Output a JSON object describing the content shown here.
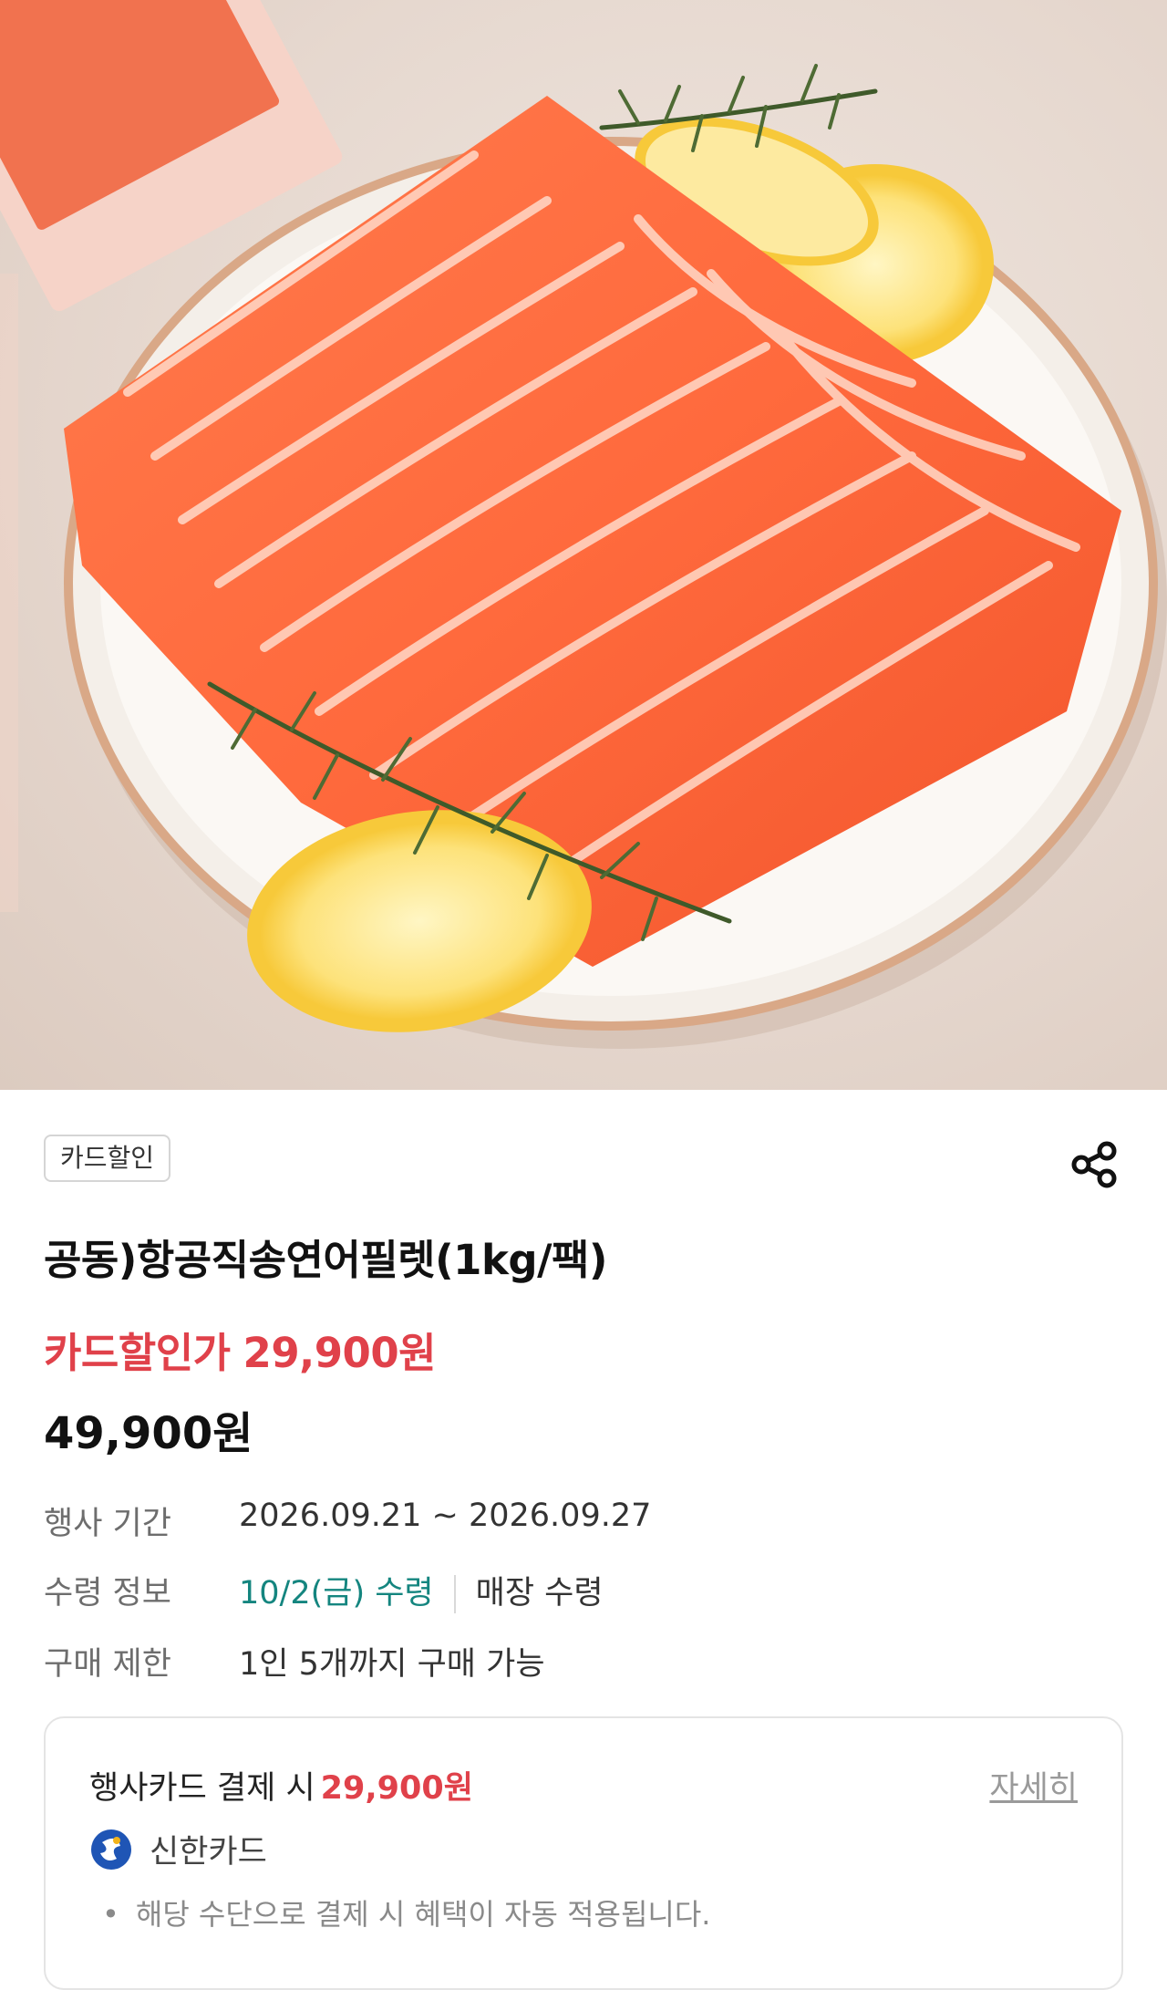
{
  "product": {
    "badge": "카드할인",
    "title": "공동)항공직송연어필렛(1kg/팩)",
    "card_price_label": "카드할인가",
    "card_price": "29,900원",
    "original_price": "49,900원"
  },
  "details": [
    {
      "key": "행사 기간",
      "value": "2026.09.21 ~ 2026.09.27"
    },
    {
      "key": "수령 정보",
      "value_date": "10/2(금) 수령",
      "value_method": "매장 수령"
    },
    {
      "key": "구매 제한",
      "value": "1인 5개까지 구매 가능"
    }
  ],
  "payment": {
    "title": "행사카드 결제 시",
    "amount": "29,900원",
    "detail_link": "자세히",
    "card_name": "신한카드",
    "note": "해당 수단으로 결제 시 혜택이 자동 적용됩니다."
  },
  "icons": {
    "share": "share-icon",
    "card_logo": "shinhan-card-logo"
  },
  "colors": {
    "accent_red": "#e0414a",
    "pickup_teal": "#14857f"
  }
}
